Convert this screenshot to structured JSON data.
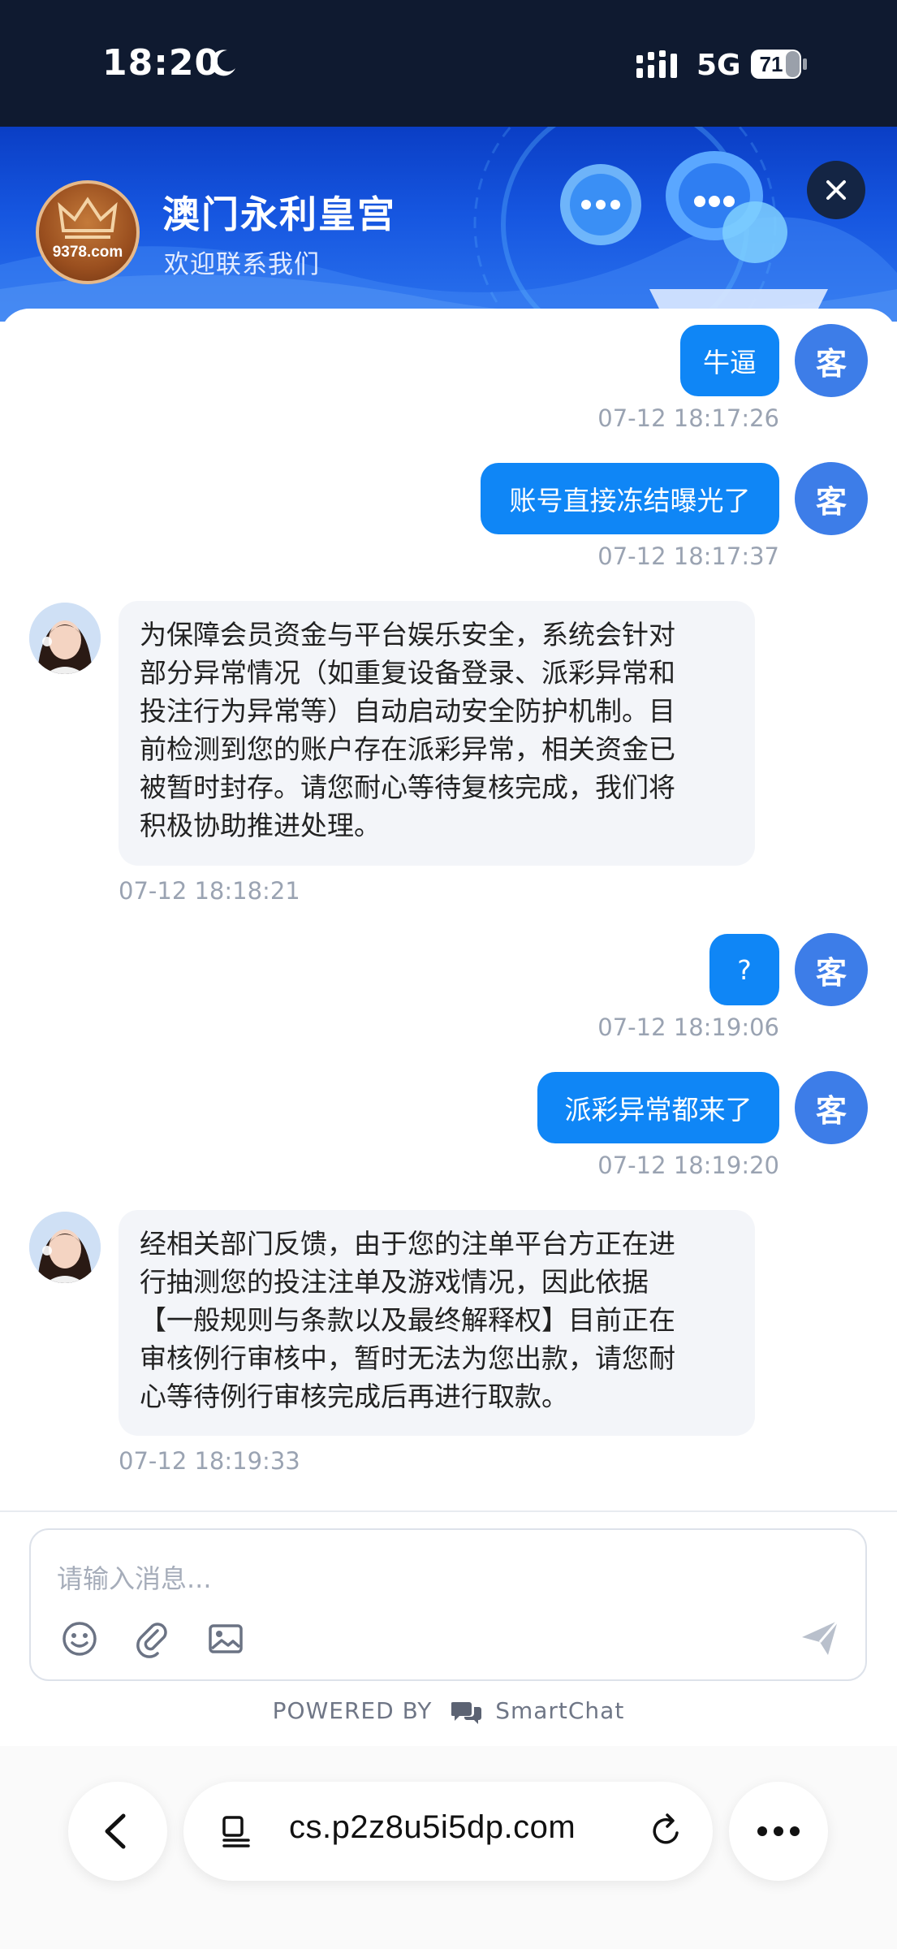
{
  "status_bar": {
    "time": "18:20",
    "network": "5G",
    "battery": "71"
  },
  "header": {
    "logo_text": "9378.com",
    "title": "澳门永利皇宫",
    "subtitle": "欢迎联系我们"
  },
  "customer_avatar_label": "客",
  "messages": {
    "m1": {
      "text": "牛逼",
      "time": "07-12 18:17:26"
    },
    "m2": {
      "text": "账号直接冻结曝光了",
      "time": "07-12 18:17:37"
    },
    "m3": {
      "lines": [
        "为保障会员资金与平台娱乐安全，系统会针对",
        "部分异常情况（如重复设备登录、派彩异常和",
        "投注行为异常等）自动启动安全防护机制。目",
        "前检测到您的账户存在派彩异常，相关资金已",
        "被暂时封存。请您耐心等待复核完成，我们将",
        "积极协助推进处理。"
      ],
      "time": "07-12 18:18:21"
    },
    "m4": {
      "text": "?",
      "time": "07-12 18:19:06"
    },
    "m5": {
      "text": "派彩异常都来了",
      "time": "07-12 18:19:20"
    },
    "m6": {
      "lines": [
        "经相关部门反馈，由于您的注单平台方正在进",
        "行抽测您的投注注单及游戏情况，因此依据",
        "【一般规则与条款以及最终解释权】目前正在",
        "审核例行审核中，暂时无法为您出款，请您耐",
        "心等待例行审核完成后再进行取款。"
      ],
      "time": "07-12 18:19:33"
    }
  },
  "composer": {
    "placeholder": "请输入消息..."
  },
  "powered": {
    "prefix": "POWERED BY",
    "brand": "SmartChat"
  },
  "browser": {
    "url": "cs.p2z8u5i5dp.com"
  },
  "colors": {
    "customer_bubble": "#0f86f6",
    "customer_avatar": "#3d7de8",
    "header_blue": "#1656e0"
  }
}
